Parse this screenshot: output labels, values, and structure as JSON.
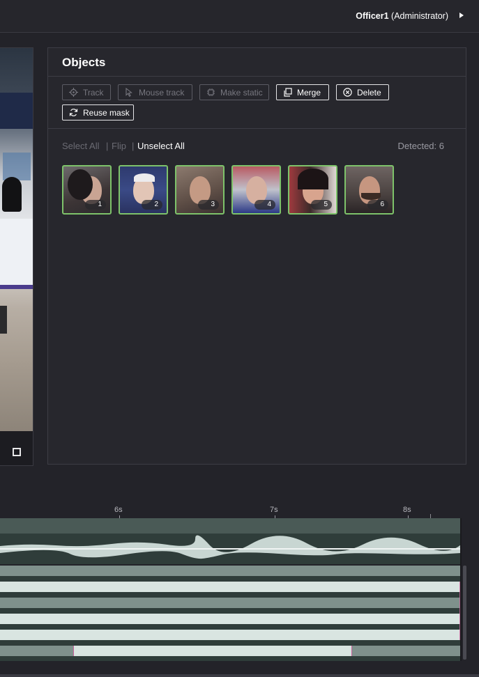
{
  "header": {
    "user_name": "Officer1",
    "user_role": "(Administrator)"
  },
  "objects_panel": {
    "title": "Objects",
    "toolbar": {
      "track": "Track",
      "mouse_track": "Mouse track",
      "make_static": "Make static",
      "merge": "Merge",
      "delete": "Delete",
      "reuse_mask": "Reuse mask"
    },
    "selection": {
      "select_all": "Select All",
      "separator": "|",
      "flip": "Flip",
      "unselect_all": "Unselect All"
    },
    "detected_label": "Detected: 6",
    "thumbnails": [
      {
        "number": "1"
      },
      {
        "number": "2"
      },
      {
        "number": "3"
      },
      {
        "number": "4"
      },
      {
        "number": "5"
      },
      {
        "number": "6"
      }
    ]
  },
  "timeline": {
    "ticks": [
      "6s",
      "7s",
      "8s"
    ]
  },
  "colors": {
    "background": "#232329",
    "panel": "#27272d",
    "thumb_border": "#7ec36a",
    "track_light": "#d9e5e1",
    "track_mid": "#7f918c",
    "track_dark": "#2f3d3a",
    "marker": "#c8609a"
  },
  "icons": {
    "track": "crosshair-icon",
    "mouse_track": "cursor-icon",
    "make_static": "chip-icon",
    "merge": "copy-icon",
    "delete": "circle-x-icon",
    "reuse_mask": "refresh-icon",
    "fullscreen": "fullscreen-icon",
    "user_menu": "triangle-right-icon"
  }
}
